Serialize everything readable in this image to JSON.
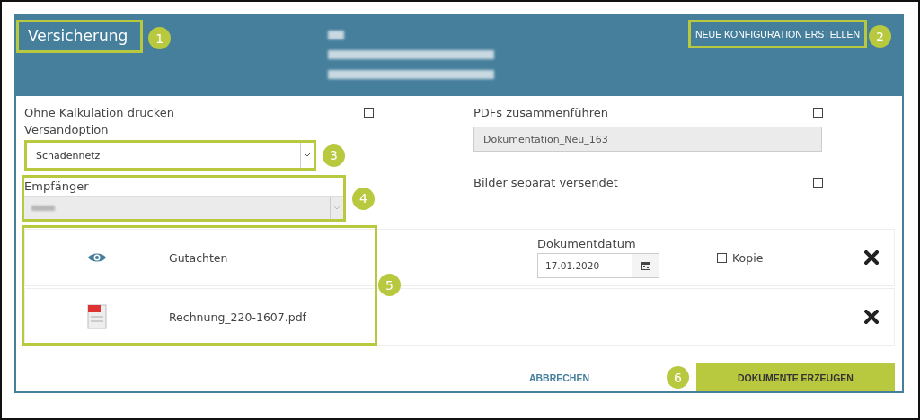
{
  "header": {
    "title": "Versicherung",
    "title_callout": "1",
    "action": "NEUE KONFIGURATION ERSTELLEN",
    "action_callout": "2"
  },
  "left": {
    "print_option": {
      "label": "Ohne Kalkulation drucken",
      "checked": false
    },
    "shipping": {
      "label": "Versandoption",
      "value": "Schadennetz",
      "callout": "3"
    },
    "recipient": {
      "label": "Empfänger",
      "disabled": true,
      "callout": "4"
    }
  },
  "right": {
    "merge": {
      "label": "PDFs zusammenführen",
      "checked": false
    },
    "filename": {
      "value": "Dokumentation_Neu_163"
    },
    "images": {
      "label": "Bilder separat versendet",
      "checked": false
    }
  },
  "documents": {
    "callout": "5",
    "rows": [
      {
        "kind": "preview",
        "name": "Gutachten",
        "date_label": "Dokumentdatum",
        "date": "17.01.2020",
        "copy": {
          "label": "Kopie",
          "checked": false
        }
      },
      {
        "kind": "pdf",
        "name": "Rechnung_220-1607.pdf"
      }
    ]
  },
  "footer": {
    "cancel": "ABBRECHEN",
    "submit": "DOKUMENTE ERZEUGEN",
    "callout": "6"
  }
}
